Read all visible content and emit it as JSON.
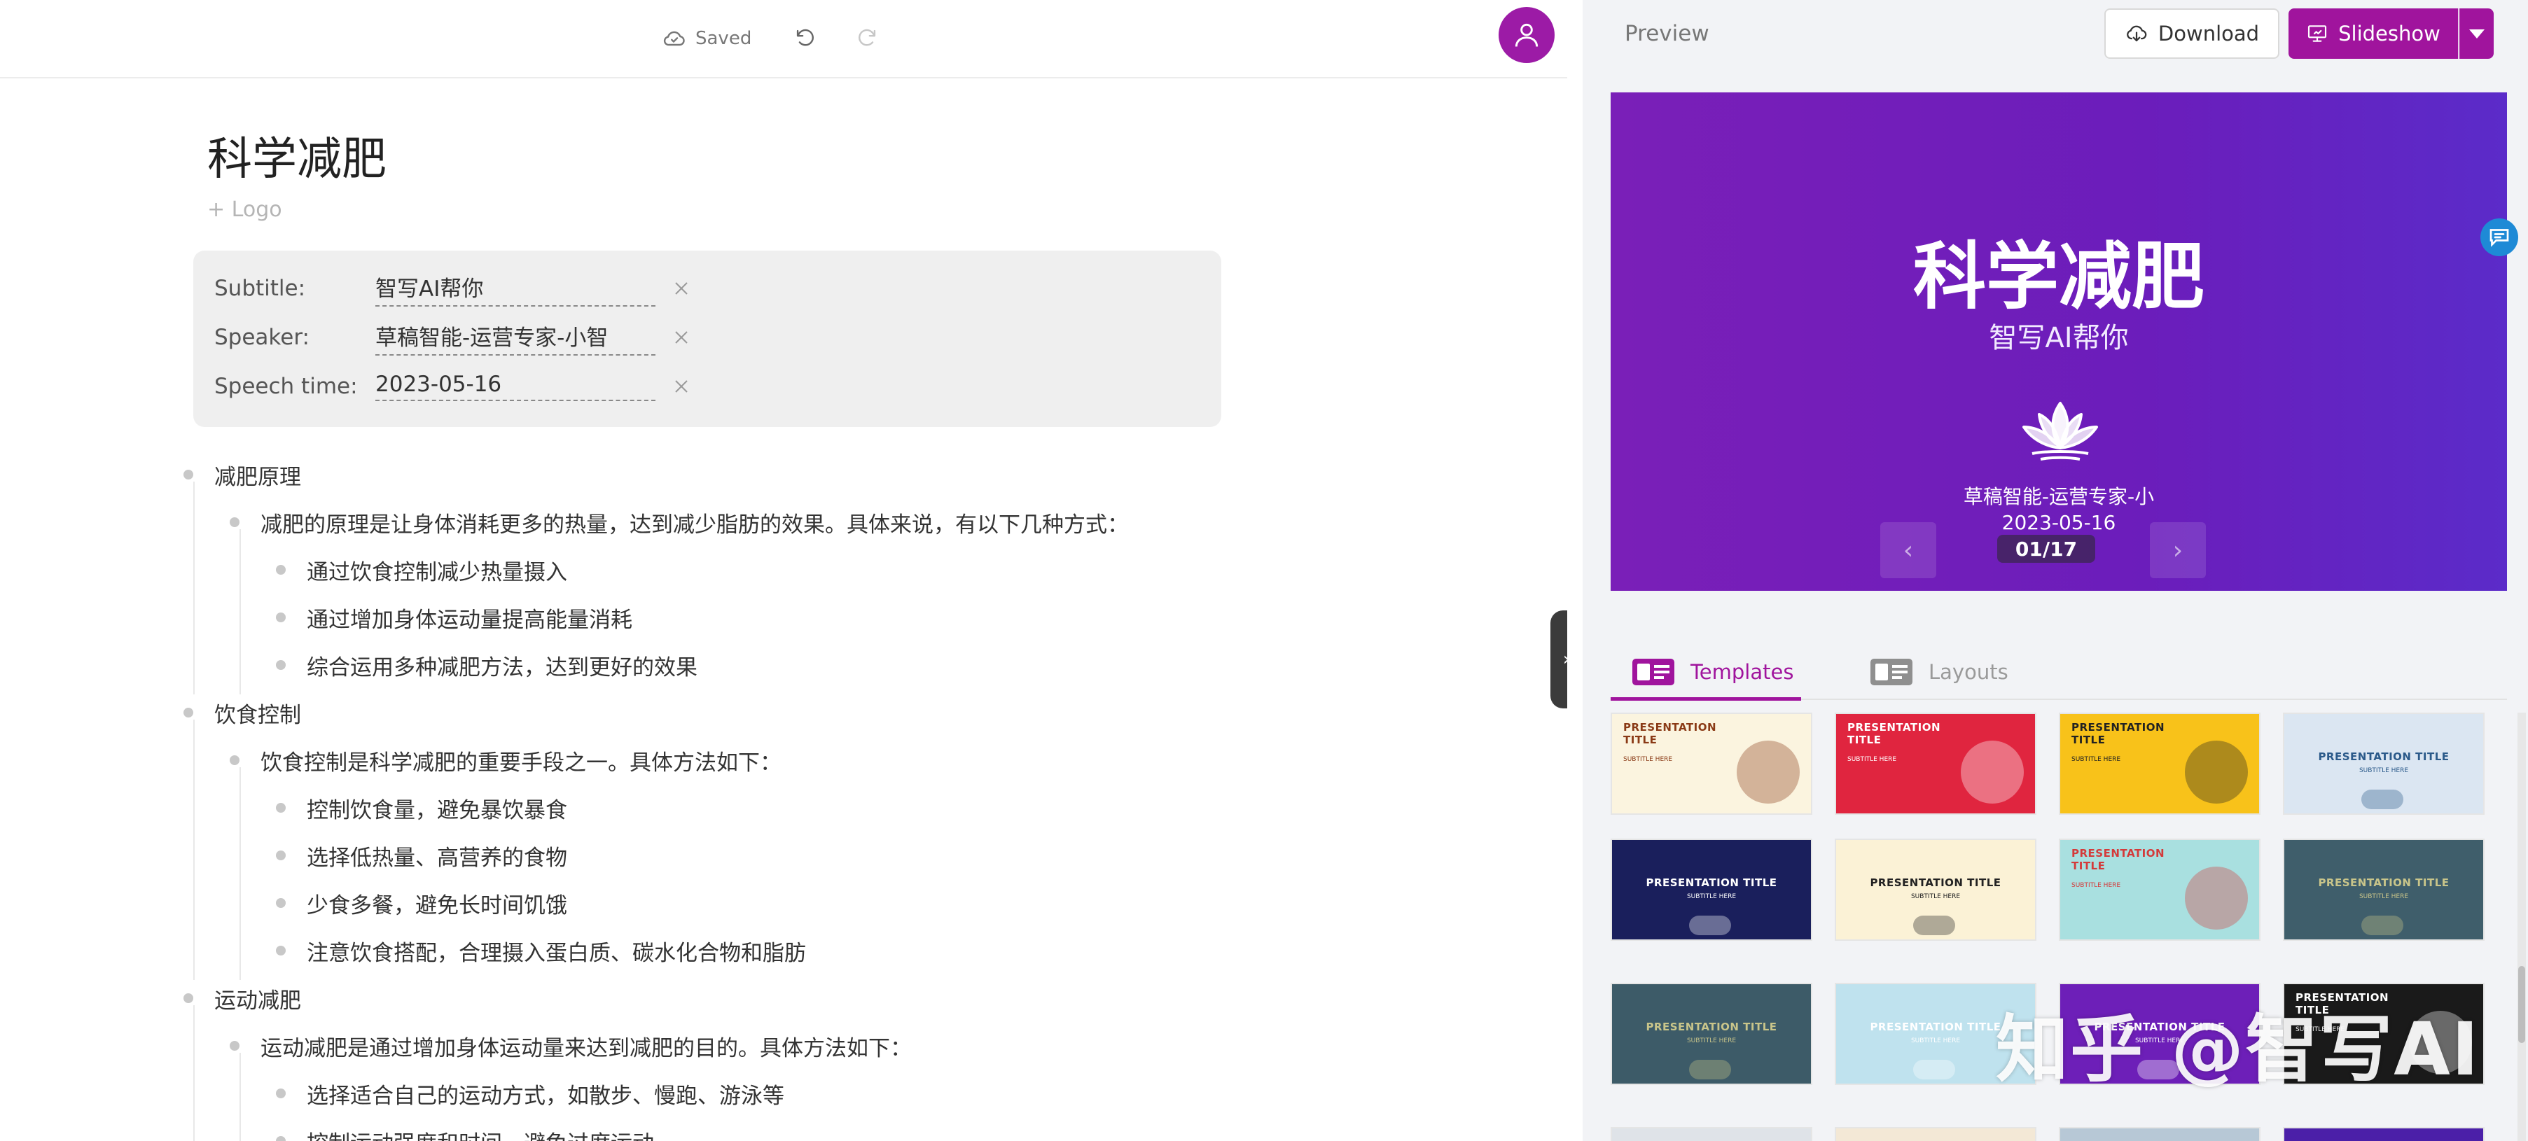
{
  "topbar": {
    "saved_label": "Saved"
  },
  "document": {
    "title": "科学减肥",
    "logo_link": "+ Logo",
    "meta": [
      {
        "label": "Subtitle:",
        "value": "智写AI帮你"
      },
      {
        "label": "Speaker:",
        "value": "草稿智能-运营专家-小智"
      },
      {
        "label": "Speech time:",
        "value": "2023-05-16"
      }
    ],
    "outline": [
      {
        "level": 0,
        "text": "减肥原理"
      },
      {
        "level": 1,
        "text": "减肥的原理是让身体消耗更多的热量，达到减少脂肪的效果。具体来说，有以下几种方式："
      },
      {
        "level": 2,
        "text": "通过饮食控制减少热量摄入"
      },
      {
        "level": 2,
        "text": "通过增加身体运动量提高能量消耗"
      },
      {
        "level": 2,
        "text": "综合运用多种减肥方法，达到更好的效果"
      },
      {
        "level": 0,
        "text": "饮食控制"
      },
      {
        "level": 1,
        "text": "饮食控制是科学减肥的重要手段之一。具体方法如下："
      },
      {
        "level": 2,
        "text": "控制饮食量，避免暴饮暴食"
      },
      {
        "level": 2,
        "text": "选择低热量、高营养的食物"
      },
      {
        "level": 2,
        "text": "少食多餐，避免长时间饥饿"
      },
      {
        "level": 2,
        "text": "注意饮食搭配，合理摄入蛋白质、碳水化合物和脂肪"
      },
      {
        "level": 0,
        "text": "运动减肥"
      },
      {
        "level": 1,
        "text": "运动减肥是通过增加身体运动量来达到减肥的目的。具体方法如下："
      },
      {
        "level": 2,
        "text": "选择适合自己的运动方式，如散步、慢跑、游泳等"
      },
      {
        "level": 2,
        "text": "控制运动强度和时间，避免过度运动"
      }
    ]
  },
  "panel": {
    "preview_label": "Preview",
    "download_label": "Download",
    "slideshow_label": "Slideshow",
    "slide": {
      "title": "科学减肥",
      "subtitle": "智写AI帮你",
      "speaker": "草稿智能-运营专家-小",
      "date": "2023-05-16",
      "counter": "01/17",
      "bg_color": "#6b1dbb"
    },
    "tabs": {
      "templates": "Templates",
      "layouts": "Layouts"
    },
    "templates": [
      {
        "title": "PRESENTATION\nTITLE",
        "sub": "SUBTITLE HERE",
        "bg": "#fbf4df",
        "fg": "#8a3a16"
      },
      {
        "title": "PRESENTATION\nTITLE",
        "sub": "SUBTITLE HERE",
        "bg": "#e0253f",
        "fg": "#ffffff"
      },
      {
        "title": "PRESENTATION\nTITLE",
        "sub": "SUBTITLE HERE",
        "bg": "#f8c21a",
        "fg": "#222222"
      },
      {
        "title": "PRESENTATION TITLE",
        "sub": "SUBTITLE HERE",
        "bg": "#dbe6f2",
        "fg": "#2b5a8a"
      },
      {
        "title": "PRESENTATION TITLE",
        "sub": "SUBTITLE HERE",
        "bg": "#1a1f5c",
        "fg": "#ffffff"
      },
      {
        "title": "PRESENTATION TITLE",
        "sub": "SUBTITLE HERE",
        "bg": "#fbf2d6",
        "fg": "#222222"
      },
      {
        "title": "PRESENTATION\nTITLE",
        "sub": "SUBTITLE HERE",
        "bg": "#a9e0e0",
        "fg": "#d43a3a"
      },
      {
        "title": "PRESENTATION TITLE",
        "sub": "SUBTITLE HERE",
        "bg": "#3f5e6b",
        "fg": "#c9c58a"
      },
      {
        "title": "PRESENTATION TITLE",
        "sub": "SUBTITLE HERE",
        "bg": "#3d5b68",
        "fg": "#c9c58a"
      },
      {
        "title": "PRESENTATION TITLE",
        "sub": "SUBTITLE HERE",
        "bg": "#bfe2ee",
        "fg": "#ffffff"
      },
      {
        "title": "PRESENTATION TITLE",
        "sub": "SUBTITLE HERE",
        "bg": "#6d1fb8",
        "fg": "#ffffff"
      },
      {
        "title": "PRESENTATION\nTITLE",
        "sub": "SUBTITLE HERE",
        "bg": "#1a1a1a",
        "fg": "#ffffff"
      }
    ],
    "watermark": "知乎 @智写AI",
    "accent_color": "#a0149d"
  }
}
